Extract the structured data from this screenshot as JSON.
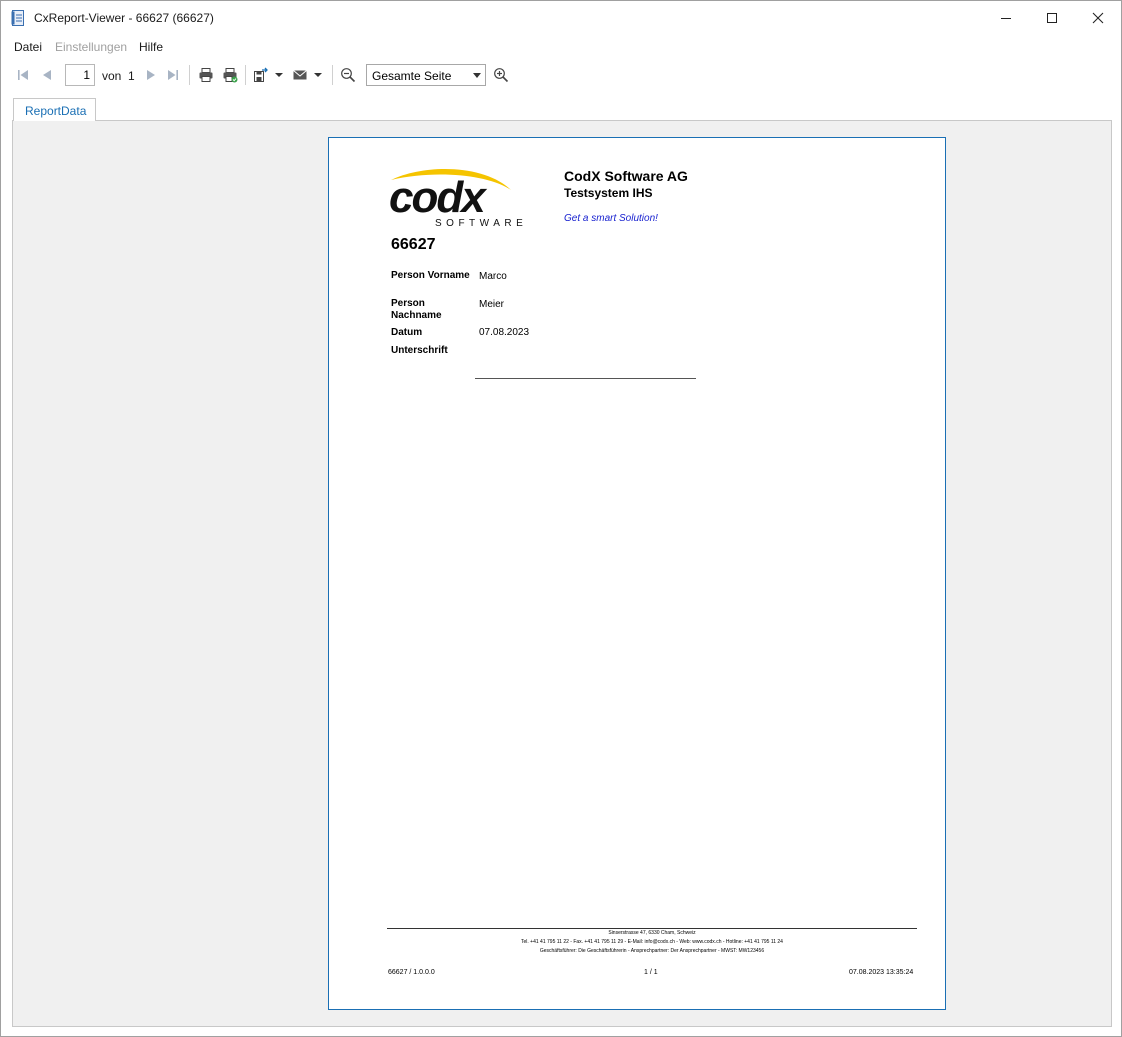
{
  "window": {
    "title": "CxReport-Viewer - 66627 (66627)"
  },
  "menu": {
    "items": [
      {
        "label": "Datei",
        "enabled": true
      },
      {
        "label": "Einstellungen",
        "enabled": false
      },
      {
        "label": "Hilfe",
        "enabled": true
      }
    ]
  },
  "toolbar": {
    "current_page": "1",
    "of_label": "von",
    "total_pages": "1",
    "zoom_value": "Gesamte Seite",
    "icons": [
      "first-page-icon",
      "previous-page-icon",
      "next-page-icon",
      "last-page-icon",
      "print-icon",
      "print-direct-icon",
      "export-icon",
      "email-icon",
      "zoom-out-icon",
      "zoom-in-icon"
    ]
  },
  "tabs": [
    {
      "label": "ReportData",
      "active": true
    }
  ],
  "report": {
    "logo_text": "codx",
    "logo_subtext": "SOFTWARE",
    "company": "CodX Software AG",
    "system": "Testsystem IHS",
    "slogan": "Get a smart Solution!",
    "id": "66627",
    "fields": [
      {
        "label": "Person Vorname",
        "value": "Marco"
      },
      {
        "label": "Person Nachname",
        "value": "Meier"
      },
      {
        "label": "Datum",
        "value": "07.08.2023"
      },
      {
        "label": "Unterschrift",
        "value": ""
      }
    ],
    "footer": {
      "address": "Sinserstrasse 47, 6330 Cham, Schweiz",
      "contact": "Tel. +41 41 795 11 22 - Fax. +41 41 795 11 29 - E-Mail: info@codx.ch - Web: www.codx.ch - Hotline: +41 41 795 11 24",
      "management": "Geschäftsführer: Die Geschäftsführerin - Ansprechpartner: Der Ansprechpartner - MWST: MW123456",
      "left": "66627 / 1.0.0.0",
      "center": "1 / 1",
      "right": "07.08.2023 13:35:24"
    }
  },
  "colors": {
    "accent": "#1a6fb4",
    "slogan": "#1a23d0",
    "logo_swoosh": "#f5c400"
  }
}
